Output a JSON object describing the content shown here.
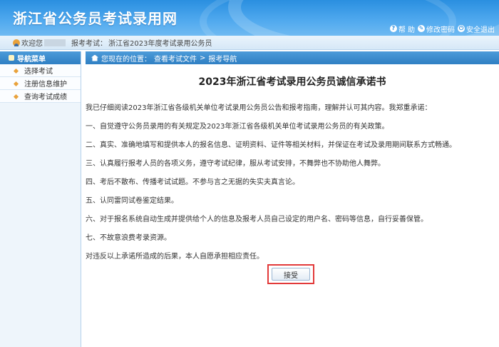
{
  "header": {
    "title": "浙江省公务员考试录用网"
  },
  "toplinks": [
    {
      "icon": "help-icon",
      "label": "帮 助"
    },
    {
      "icon": "password-icon",
      "label": "修改密码"
    },
    {
      "icon": "logout-icon",
      "label": "安全退出"
    }
  ],
  "status": {
    "welcome": "欢迎您",
    "exam_label": "报考考试：",
    "exam_name": "浙江省2023年度考试录用公务员"
  },
  "sidebar": {
    "heading": "导航菜单",
    "items": [
      {
        "label": "选择考试"
      },
      {
        "label": "注册信息维护"
      },
      {
        "label": "查询考试成绩"
      }
    ]
  },
  "breadcrumb": {
    "prefix": "您现在的位置：",
    "link1": "查看考试文件",
    "separator": ">",
    "link2": "报考导航"
  },
  "document": {
    "title": "2023年浙江省考试录用公务员诚信承诺书",
    "intro": "我已仔细阅读2023年浙江省各级机关单位考试录用公务员公告和报考指南，理解并认可其内容。我郑重承诺：",
    "items": [
      "一、自觉遵守公务员录用的有关规定及2023年浙江省各级机关单位考试录用公务员的有关政策。",
      "二、真实、准确地填写和提供本人的报名信息、证明资料、证件等相关材料，并保证在考试及录用期间联系方式畅通。",
      "三、认真履行报考人员的各项义务，遵守考试纪律，服从考试安排，不舞弊也不协助他人舞弊。",
      "四、考后不散布、传播考试试题。不参与言之无据的失实夫真言论。",
      "五、认同雷同试卷鉴定结果。",
      "六、对于报名系统自动生成并提供给个人的信息及报考人员自己设定的用户名、密码等信息，自行妥善保管。",
      "七、不故意浪费考录资源。"
    ],
    "closing": "对违反以上承诺所造成的后果，本人自愿承担相应责任。",
    "accept_label": "接受"
  }
}
